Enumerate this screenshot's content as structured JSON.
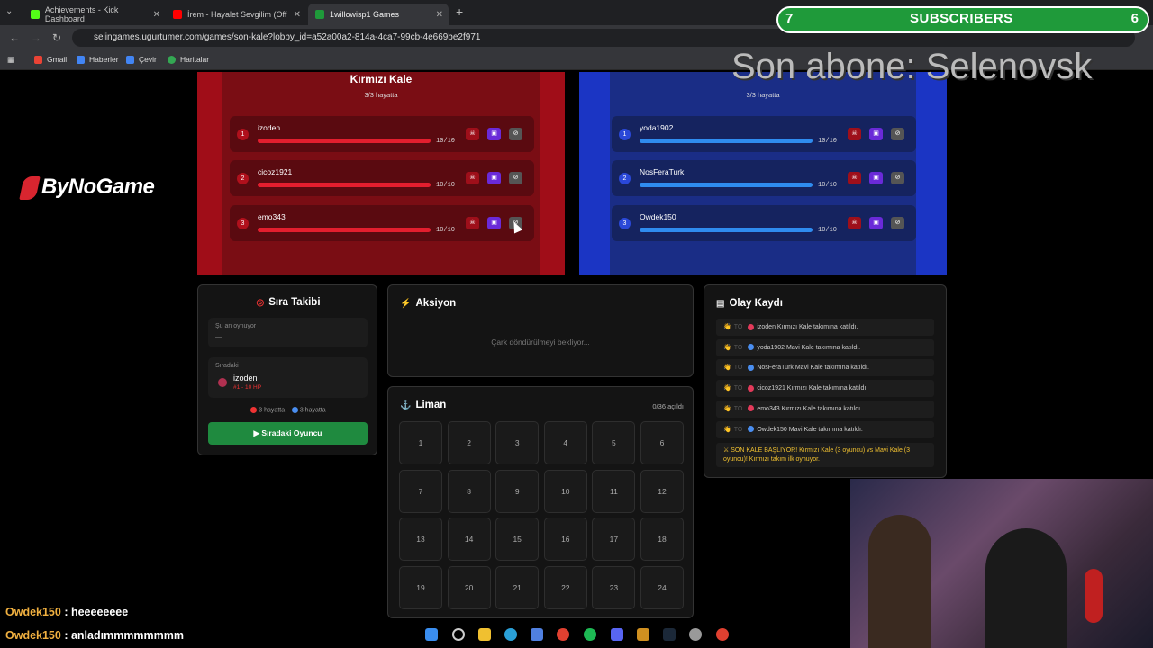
{
  "browser": {
    "tabs": [
      {
        "title": "Achievements - Kick Dashboard",
        "color": "#53fc18"
      },
      {
        "title": "İrem - Hayalet Sevgilim (Off",
        "color": "#ff0000"
      },
      {
        "title": "1willowisp1 Games",
        "color": "#1f9a3a"
      }
    ],
    "url": "selingames.ugurtumer.com/games/son-kale?lobby_id=a52a00a2-814a-4ca7-99cb-4e669be2f971",
    "bookmarks": [
      "Gmail",
      "Haberler",
      "Çevir",
      "Haritalar"
    ]
  },
  "overlay": {
    "subs_left": "7",
    "subs_label": "SUBSCRIBERS",
    "subs_right": "6",
    "last_sub": "Son abone: Selenovsk"
  },
  "logo": "ByNoGame",
  "red_team": {
    "title": "Kırmızı Kale",
    "subtitle": "3/3 hayatta",
    "color": "#e31e2e",
    "players": [
      {
        "num": "1",
        "name": "izoden",
        "hp": "10/10"
      },
      {
        "num": "2",
        "name": "cicoz1921",
        "hp": "10/10"
      },
      {
        "num": "3",
        "name": "emo343",
        "hp": "10/10"
      }
    ]
  },
  "blue_team": {
    "title": "",
    "subtitle": "3/3 hayatta",
    "color": "#2f8cf0",
    "players": [
      {
        "num": "1",
        "name": "yoda1902",
        "hp": "10/10"
      },
      {
        "num": "2",
        "name": "NosFeraTurk",
        "hp": "10/10"
      },
      {
        "num": "3",
        "name": "Owdek150",
        "hp": "10/10"
      }
    ]
  },
  "turn": {
    "title": "Sıra Takibi",
    "now_label": "Şu an oynuyor",
    "now_value": "—",
    "next_label": "Sıradaki",
    "next_name": "izoden",
    "next_info": "#1 - 10 HP",
    "red_alive": "3 hayatta",
    "blue_alive": "3 hayatta",
    "next_button": "Sıradaki Oyuncu"
  },
  "action": {
    "title": "Aksiyon",
    "waiting": "Çark döndürülmeyi bekliyor..."
  },
  "harbor": {
    "title": "Liman",
    "opened": "0/36 açıldı",
    "cells": [
      "1",
      "2",
      "3",
      "4",
      "5",
      "6",
      "7",
      "8",
      "9",
      "10",
      "11",
      "12",
      "13",
      "14",
      "15",
      "16",
      "17",
      "18",
      "19",
      "20",
      "21",
      "22",
      "23",
      "24"
    ]
  },
  "eventlog": {
    "title": "Olay Kaydı",
    "entries": [
      {
        "team": "red",
        "text": "izoden Kırmızı Kale takımına katıldı."
      },
      {
        "team": "blue",
        "text": "yoda1902 Mavi Kale takımına katıldı."
      },
      {
        "team": "blue",
        "text": "NosFeraTurk Mavi Kale takımına katıldı."
      },
      {
        "team": "red",
        "text": "cicoz1921 Kırmızı Kale takımına katıldı."
      },
      {
        "team": "red",
        "text": "emo343 Kırmızı Kale takımına katıldı."
      },
      {
        "team": "blue",
        "text": "Owdek150 Mavi Kale takımına katıldı."
      }
    ],
    "time_label": "TO",
    "final": "SON KALE BAŞLIYOR! Kırmızı Kale (3 oyuncu) vs Mavi Kale (3 oyuncu)! Kırmızı takım ilk oynuyor."
  },
  "chat": [
    {
      "user": "Owdek150",
      "msg": ": heeeeeeee"
    },
    {
      "user": "Owdek150",
      "msg": ": anladımmmmmmmm"
    }
  ]
}
